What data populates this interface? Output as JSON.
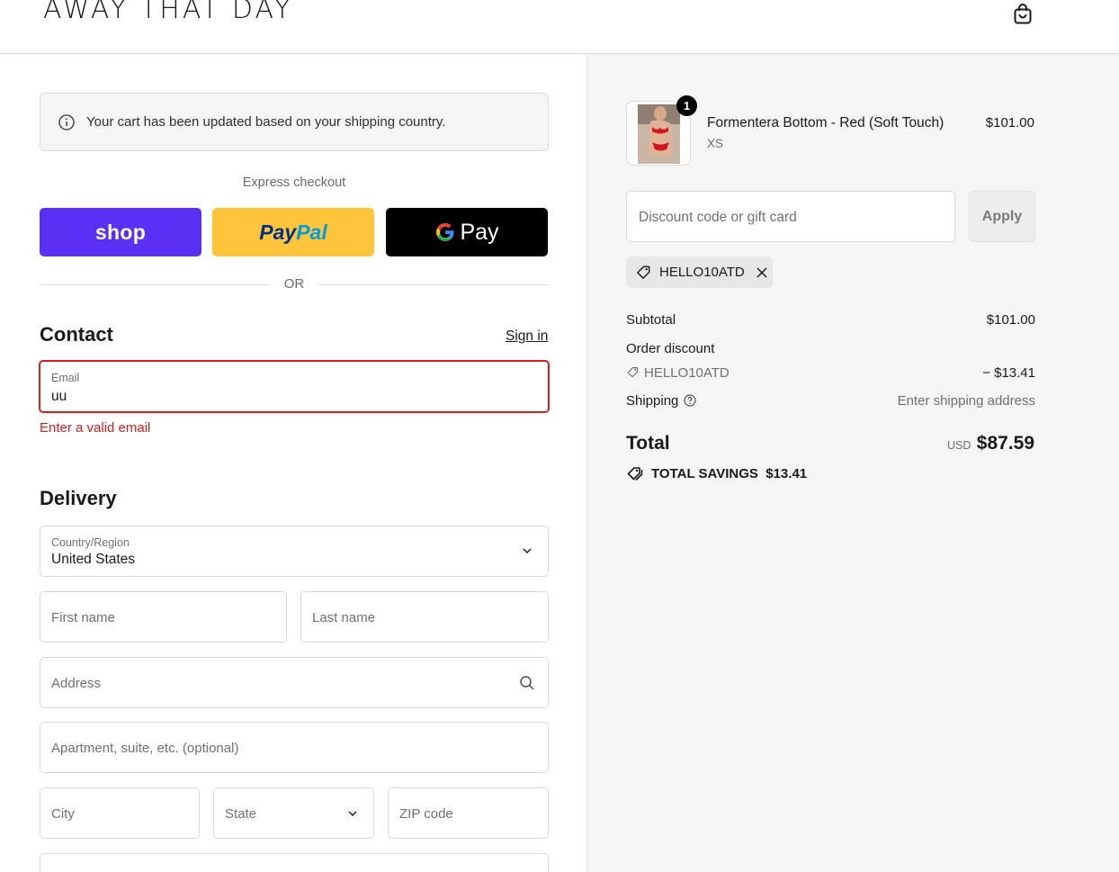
{
  "header": {
    "logo": "AWAY THAT DAY",
    "cart_icon": "shopping-bag-icon"
  },
  "notice": {
    "icon": "info-circle-icon",
    "text": "Your cart has been updated based on your shipping country."
  },
  "express": {
    "label": "Express checkout",
    "shop_label": "shop",
    "paypal_label_1": "Pay",
    "paypal_label_2": "Pal",
    "gpay_label": "Pay",
    "or_label": "OR"
  },
  "contact": {
    "title": "Contact",
    "sign_in": "Sign in",
    "email_label": "Email",
    "email_value": "uu",
    "error": "Enter a valid email"
  },
  "delivery": {
    "title": "Delivery",
    "country_label": "Country/Region",
    "country_value": "United States",
    "first_name_placeholder": "First name",
    "last_name_placeholder": "Last name",
    "address_placeholder": "Address",
    "apartment_placeholder": "Apartment, suite, etc. (optional)",
    "city_placeholder": "City",
    "state_placeholder": "State",
    "zip_placeholder": "ZIP code"
  },
  "order": {
    "item": {
      "quantity": "1",
      "name": "Formentera Bottom - Red (Soft Touch)",
      "variant": "XS",
      "price": "$101.00"
    },
    "discount_placeholder": "Discount code or gift card",
    "apply_label": "Apply",
    "applied_code": "HELLO10ATD",
    "subtotal_label": "Subtotal",
    "subtotal_value": "$101.00",
    "order_discount_label": "Order discount",
    "discount_code": "HELLO10ATD",
    "discount_value": "− $13.41",
    "shipping_label": "Shipping",
    "shipping_value": "Enter shipping address",
    "total_label": "Total",
    "currency": "USD",
    "total_value": "$87.59",
    "savings_label": "TOTAL SAVINGS",
    "savings_value": "$13.41"
  },
  "colors": {
    "shop_purple": "#5a31f4",
    "paypal_yellow": "#ffc439",
    "error_red": "#dd1d1d"
  }
}
